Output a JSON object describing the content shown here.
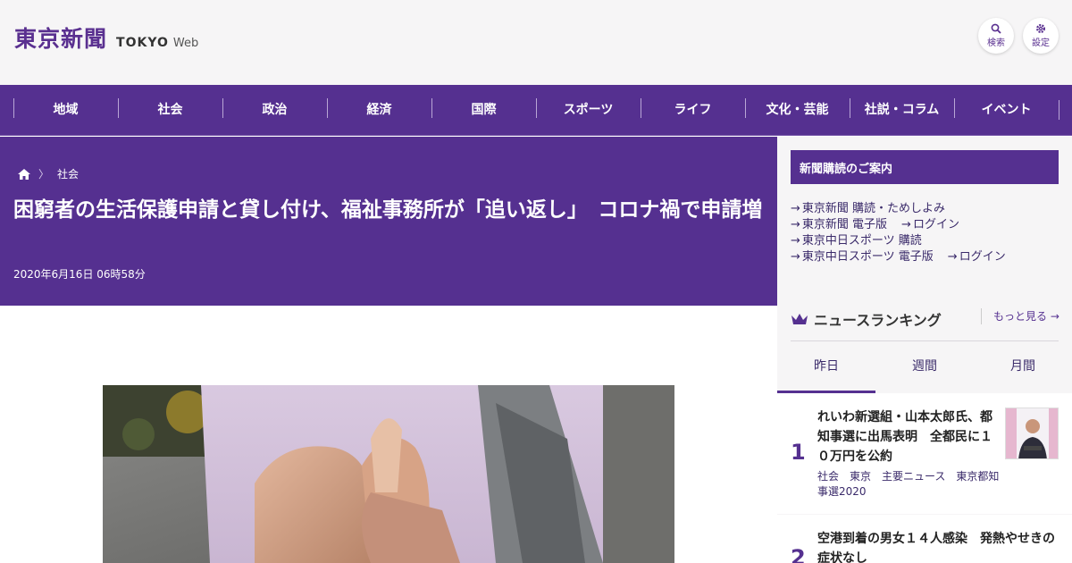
{
  "header": {
    "logo_kanji": "東京新聞",
    "logo_en": "TOKYO",
    "logo_web": "Web",
    "search_label": "検索",
    "settings_label": "設定"
  },
  "nav": {
    "items": [
      "地域",
      "社会",
      "政治",
      "経済",
      "国際",
      "スポーツ",
      "ライフ",
      "文化・芸能",
      "社説・コラム",
      "イベント"
    ]
  },
  "article": {
    "breadcrumb": "社会",
    "title": "困窮者の生活保護申請と貸し付け、福祉事務所が「追い返し」　コロナ禍で申請増",
    "date": "2020年6月16日 06時58分"
  },
  "sidebar": {
    "subscription_heading": "新聞購読のご案内",
    "links": [
      [
        "東京新聞 購読・ためしよみ"
      ],
      [
        "東京新聞 電子版",
        "ログイン"
      ],
      [
        "東京中日スポーツ 購読"
      ],
      [
        "東京中日スポーツ 電子版",
        "ログイン"
      ]
    ],
    "ranking_title": "ニュースランキング",
    "more_label": "もっと見る",
    "tabs": [
      "昨日",
      "週間",
      "月間"
    ],
    "news": [
      {
        "rank": "1",
        "title": "れいわ新選組・山本太郎氏、都知事選に出馬表明　全都民に１０万円を公約",
        "tags": "社会　東京　主要ニュース　東京都知事選2020"
      },
      {
        "rank": "2",
        "title": "空港到着の男女１４人感染　発熱やせきの症状なし"
      }
    ]
  },
  "colors": {
    "brand_purple": "#553090",
    "header_bg": "#f6f5f6"
  }
}
